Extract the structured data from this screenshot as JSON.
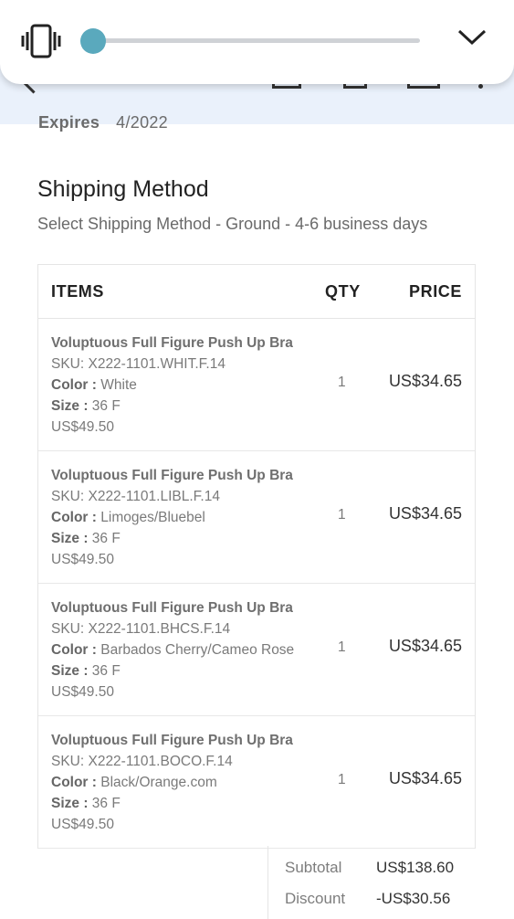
{
  "volume_panel": {
    "vibrate_icon": "vibrate-phone-icon",
    "collapse_icon": "chevron-down-icon",
    "level": 0.03,
    "accent": "#5aa9bd"
  },
  "toolbar": {
    "icons": [
      "back-arrow-icon",
      "download-icon",
      "delete-icon",
      "label-icon",
      "more-vert-icon"
    ]
  },
  "payment": {
    "expires_label": "Expires",
    "expires_value": "4/2022"
  },
  "shipping": {
    "title": "Shipping Method",
    "subtitle": "Select Shipping Method - Ground - 4-6 business days"
  },
  "table": {
    "headers": {
      "items": "ITEMS",
      "qty": "QTY",
      "price": "PRICE"
    },
    "rows": [
      {
        "name": "Voluptuous Full Figure Push Up Bra",
        "sku": "SKU: X222-1101.WHIT.F.14",
        "color_label": "Color :",
        "color": "White",
        "size_label": "Size :",
        "size": "36 F",
        "original_price": "US$49.50",
        "qty": "1",
        "price": "US$34.65"
      },
      {
        "name": "Voluptuous Full Figure Push Up Bra",
        "sku": "SKU: X222-1101.LIBL.F.14",
        "color_label": "Color :",
        "color": "Limoges/Bluebel",
        "size_label": "Size :",
        "size": "36 F",
        "original_price": "US$49.50",
        "qty": "1",
        "price": "US$34.65"
      },
      {
        "name": "Voluptuous Full Figure Push Up Bra",
        "sku": "SKU: X222-1101.BHCS.F.14",
        "color_label": "Color :",
        "color": "Barbados Cherry/Cameo Rose",
        "size_label": "Size :",
        "size": "36 F",
        "original_price": "US$49.50",
        "qty": "1",
        "price": "US$34.65"
      },
      {
        "name": "Voluptuous Full Figure Push Up Bra",
        "sku": "SKU: X222-1101.BOCO.F.14",
        "color_label": "Color :",
        "color": "Black/Orange.com",
        "size_label": "Size :",
        "size": "36 F",
        "original_price": "US$49.50",
        "qty": "1",
        "price": "US$34.65"
      }
    ]
  },
  "summary": {
    "subtotal_label": "Subtotal",
    "subtotal_value": "US$138.60",
    "discount_label": "Discount",
    "discount_value": "-US$30.56"
  }
}
